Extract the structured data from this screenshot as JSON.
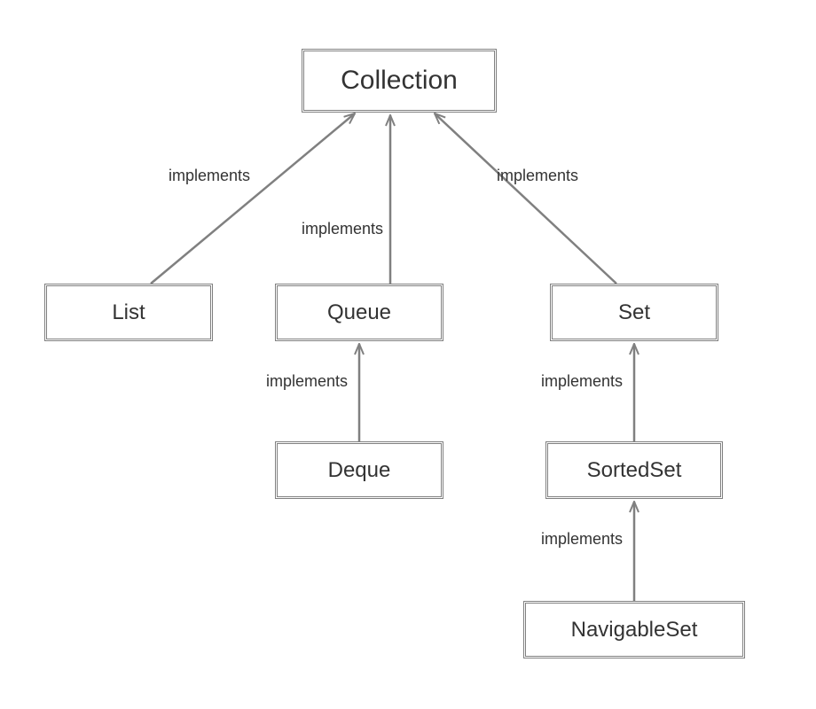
{
  "nodes": {
    "collection": "Collection",
    "list": "List",
    "queue": "Queue",
    "set": "Set",
    "deque": "Deque",
    "sortedset": "SortedSet",
    "navigableset": "NavigableSet"
  },
  "edge_label": "implements",
  "edges": [
    {
      "from": "list",
      "to": "collection",
      "label": "implements"
    },
    {
      "from": "queue",
      "to": "collection",
      "label": "implements"
    },
    {
      "from": "set",
      "to": "collection",
      "label": "implements"
    },
    {
      "from": "deque",
      "to": "queue",
      "label": "implements"
    },
    {
      "from": "sortedset",
      "to": "set",
      "label": "implements"
    },
    {
      "from": "navigableset",
      "to": "sortedset",
      "label": "implements"
    }
  ],
  "colors": {
    "line": "#808080",
    "text": "#333333",
    "bg": "#ffffff"
  }
}
